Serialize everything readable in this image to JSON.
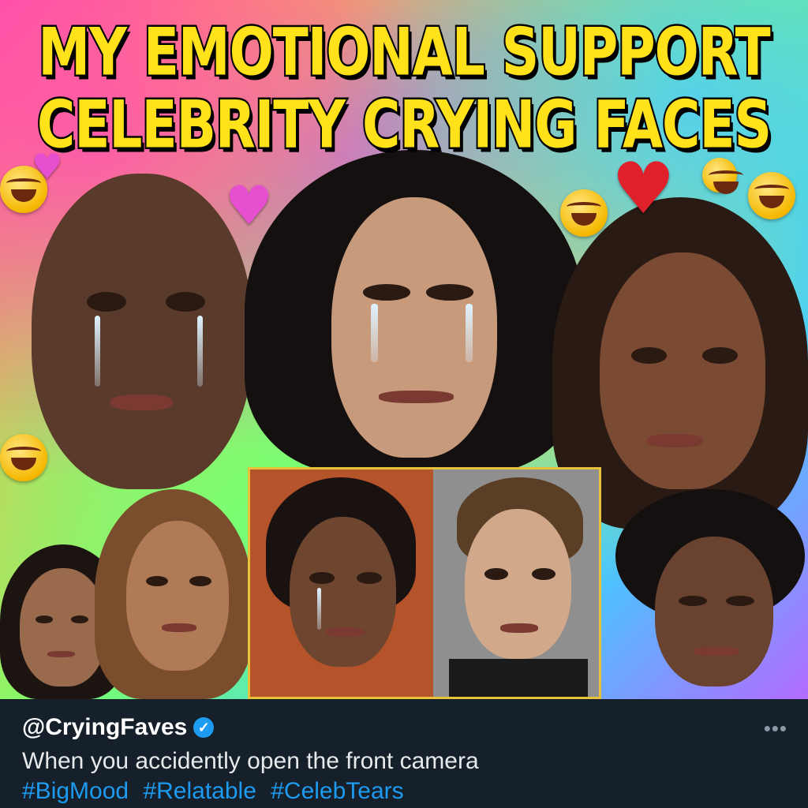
{
  "headline": {
    "line1": "MY EMOTIONAL SUPPORT",
    "line2": "CELEBRITY CRYING FACES"
  },
  "colors": {
    "headline_fill": "#ffe21a",
    "headline_stroke": "#000000",
    "tweet_background": "#15202b",
    "hashtag_blue": "#1d9bf0",
    "verified_blue": "#1d9bf0",
    "inset_border": "#e8c23a"
  },
  "decorations": {
    "icons": [
      "laughing-crying-emoji",
      "broken-heart-emoji"
    ]
  },
  "collage": {
    "faces": [
      {
        "id": "face-left-large",
        "description_icon": "crying-face-photo"
      },
      {
        "id": "face-center-large",
        "description_icon": "crying-face-photo"
      },
      {
        "id": "face-right-large",
        "description_icon": "sad-face-photo"
      },
      {
        "id": "face-bottom-1",
        "description_icon": "sad-face-photo"
      },
      {
        "id": "face-bottom-2",
        "description_icon": "sad-face-photo"
      },
      {
        "id": "face-bottom-3",
        "description_icon": "crying-face-photo"
      },
      {
        "id": "face-bottom-4",
        "description_icon": "serious-face-photo"
      },
      {
        "id": "face-bottom-5",
        "description_icon": "sad-face-photo"
      }
    ]
  },
  "tweet": {
    "handle": "@CryingFaves",
    "verified_icon": "✓",
    "more_icon": "•••",
    "caption": "When you accidently open the front camera",
    "hashtags": [
      "#BigMood",
      "#Relatable",
      "#CelebTears"
    ]
  }
}
